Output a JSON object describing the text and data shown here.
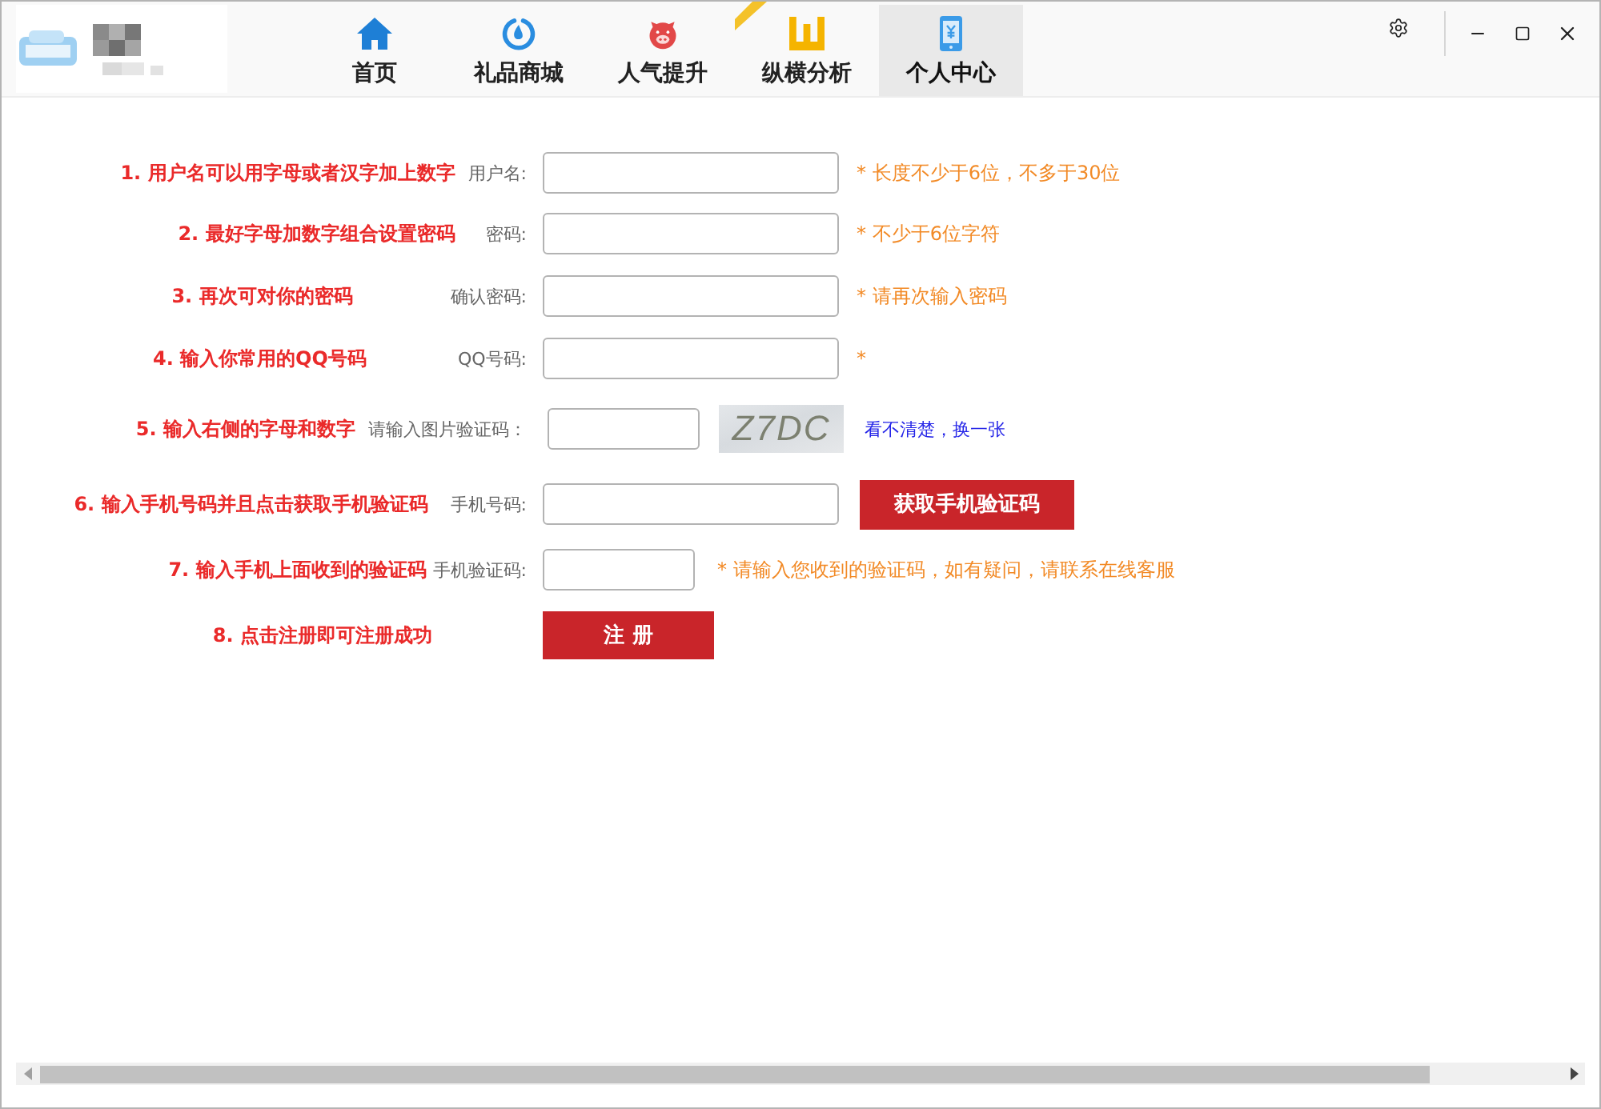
{
  "nav": {
    "tabs": [
      {
        "label": "首页",
        "selected": false,
        "ribbon": false
      },
      {
        "label": "礼品商城",
        "selected": false,
        "ribbon": false
      },
      {
        "label": "人气提升",
        "selected": false,
        "ribbon": false
      },
      {
        "label": "纵横分析",
        "selected": false,
        "ribbon": true
      },
      {
        "label": "个人中心",
        "selected": true,
        "ribbon": false
      }
    ]
  },
  "form": {
    "rows": [
      {
        "kind": "text",
        "step": "1. 用户名可以用字母或者汉字加上数字",
        "label": "用户名:",
        "hint": "* 长度不少于6位，不多于30位"
      },
      {
        "kind": "text",
        "step": "2. 最好字母加数字组合设置密码",
        "label": "密码:",
        "hint": "* 不少于6位字符"
      },
      {
        "kind": "text",
        "step": "3. 再次可对你的密码",
        "label": "确认密码:",
        "hint": "* 请再次输入密码"
      },
      {
        "kind": "text",
        "step": "4. 输入你常用的QQ号码",
        "label": "QQ号码:",
        "hint": "*"
      },
      {
        "kind": "captcha",
        "step": "5. 输入右侧的字母和数字",
        "label": "请输入图片验证码：",
        "captcha": "Z7DC",
        "link": "看不清楚，换一张"
      },
      {
        "kind": "sms",
        "step": "6. 输入手机号码并且点击获取手机验证码",
        "label": "手机号码:",
        "button": "获取手机验证码"
      },
      {
        "kind": "code",
        "step": "7. 输入手机上面收到的验证码",
        "label": "手机验证码:",
        "hint": "* 请输入您收到的验证码，如有疑问，请联系在线客服"
      },
      {
        "kind": "submit",
        "step": "8. 点击注册即可注册成功",
        "button": "注 册"
      }
    ]
  }
}
